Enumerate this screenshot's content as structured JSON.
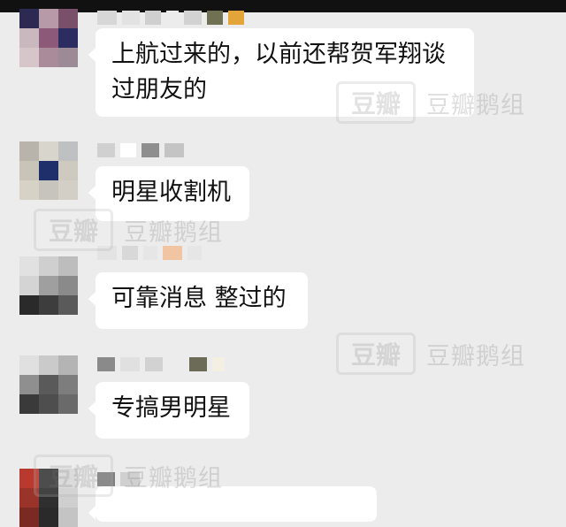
{
  "messages": [
    {
      "text": "上航过来的，以前还帮贺军翔谈过朋友的"
    },
    {
      "text": "明星收割机"
    },
    {
      "text": "可靠消息 整过的"
    },
    {
      "text": "专搞男明星"
    }
  ],
  "watermark": {
    "logo": "豆瓣",
    "text": "豆瓣鹅组"
  },
  "colors": {
    "background": "#ececec",
    "bubble": "#ffffff",
    "text": "#111111",
    "topbar": "#111111"
  }
}
